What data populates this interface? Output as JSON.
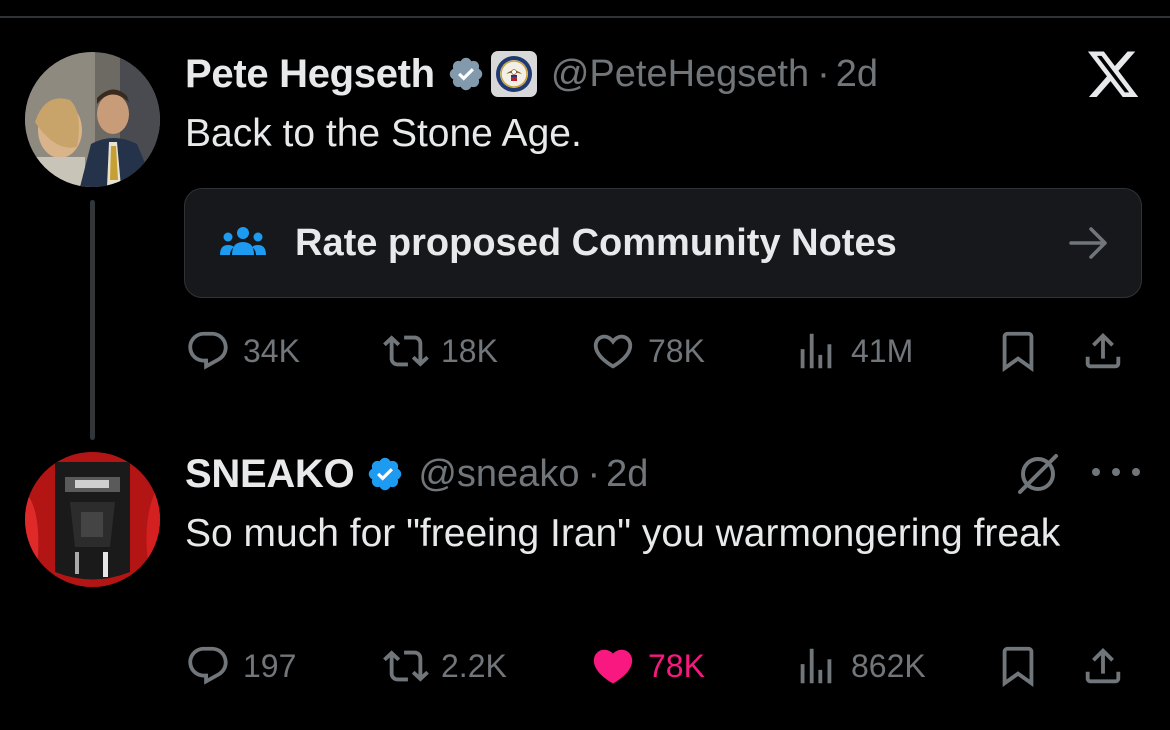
{
  "colors": {
    "background": "#000000",
    "text": "#e7e9ea",
    "muted": "#71767b",
    "verified_blue": "#1d9bf0",
    "like_pink": "#f91880",
    "notes_blue": "#1d9bf0"
  },
  "app": {
    "logo": "x-logo-icon"
  },
  "tweets": [
    {
      "author_name": "Pete Hegseth",
      "verified_badge": "verified-check-gray",
      "affiliation_badge": "department-seal-icon",
      "handle": "@PeteHegseth",
      "separator": "·",
      "time": "2d",
      "text": "Back to the Stone Age.",
      "community_notes": {
        "label": "Rate proposed Community Notes",
        "icon": "people-icon",
        "arrow": "arrow-right-icon"
      },
      "stats": {
        "replies": "34K",
        "retweets": "18K",
        "likes": "78K",
        "views": "41M",
        "liked": false
      }
    },
    {
      "author_name": "SNEAKO",
      "verified_badge": "verified-check-blue",
      "handle": "@sneako",
      "separator": "·",
      "time": "2d",
      "text": "So much for \"freeing Iran\" you warmongering freak",
      "header_icons": [
        "grok-icon",
        "more-icon"
      ],
      "stats": {
        "replies": "197",
        "retweets": "2.2K",
        "likes": "78K",
        "views": "862K",
        "liked": true
      }
    }
  ]
}
